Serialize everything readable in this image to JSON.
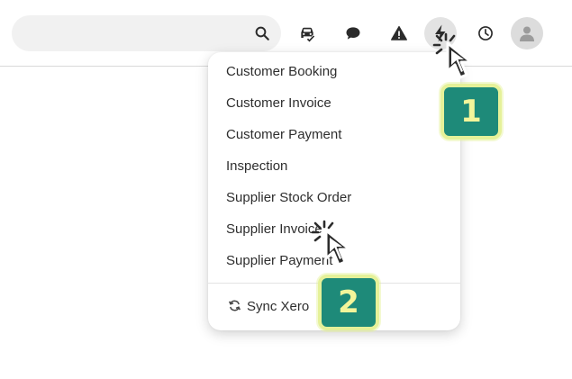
{
  "header": {
    "icons": [
      "search-icon",
      "car-check-icon",
      "chat-bubble-icon",
      "warning-icon",
      "lightning-bolt-icon",
      "clock-icon",
      "user-avatar-icon"
    ]
  },
  "quick_create_menu": {
    "items": [
      {
        "label": "Customer Booking"
      },
      {
        "label": "Customer Invoice"
      },
      {
        "label": "Customer Payment"
      },
      {
        "label": "Inspection"
      },
      {
        "label": "Supplier Stock Order"
      },
      {
        "label": "Supplier Invoice"
      },
      {
        "label": "Supplier Payment"
      }
    ],
    "sync": {
      "label": "Sync Xero",
      "icon": "refresh-icon"
    }
  },
  "callouts": [
    {
      "number": "1"
    },
    {
      "number": "2"
    }
  ],
  "colors": {
    "badge_fill": "#1e8a79",
    "badge_border": "#e5f199",
    "badge_text": "#f3f59a"
  }
}
